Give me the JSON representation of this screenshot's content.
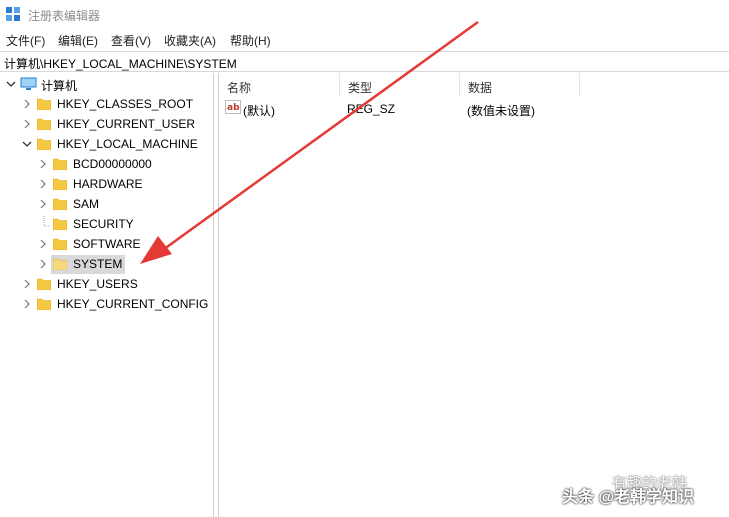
{
  "window": {
    "title": "注册表编辑器"
  },
  "menu": [
    {
      "label": "文件(F)"
    },
    {
      "label": "编辑(E)"
    },
    {
      "label": "查看(V)"
    },
    {
      "label": "收藏夹(A)"
    },
    {
      "label": "帮助(H)"
    }
  ],
  "address": {
    "path": "计算机\\HKEY_LOCAL_MACHINE\\SYSTEM"
  },
  "tree": {
    "root": "计算机",
    "hkcr": "HKEY_CLASSES_ROOT",
    "hkcu": "HKEY_CURRENT_USER",
    "hklm": "HKEY_LOCAL_MACHINE",
    "hklm_children": [
      "BCD00000000",
      "HARDWARE",
      "SAM",
      "SECURITY",
      "SOFTWARE",
      "SYSTEM"
    ],
    "hku": "HKEY_USERS",
    "hkcc": "HKEY_CURRENT_CONFIG",
    "selected": "SYSTEM"
  },
  "list": {
    "headers": [
      "名称",
      "类型",
      "数据"
    ],
    "rows": [
      {
        "icon": "ab-string-icon",
        "name": "(默认)",
        "type": "REG_SZ",
        "data": "(数值未设置)"
      }
    ]
  },
  "watermark": {
    "line1": "有趣的老韩",
    "line2": "头条 @老韩学知识"
  },
  "colors": {
    "arrow": "#e53935",
    "folder": "#f5c842",
    "selection": "#d9d9d9"
  }
}
